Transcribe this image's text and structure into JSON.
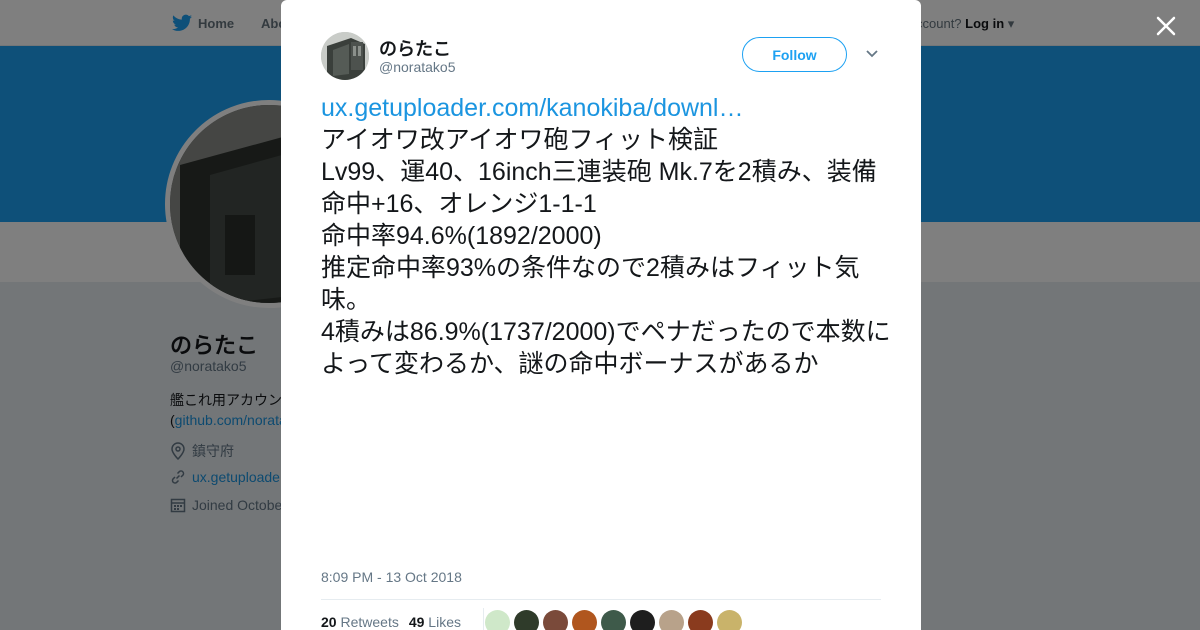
{
  "background": {
    "nav": {
      "home_label": "Home",
      "about_label": "Abo",
      "account_prompt": "ccount?",
      "login_label": "Log in"
    },
    "profile": {
      "name": "のらたこ",
      "handle": "@noratako5",
      "bio_line1": "艦これ用アカウン",
      "bio_link_prefix": "(",
      "bio_link": "github.com/norata",
      "location": "鎮守府",
      "website": "ux.getuploade",
      "joined": "Joined Octobe"
    },
    "colors": {
      "banner": "#1da1f2",
      "link": "#1b95e0"
    }
  },
  "tweet": {
    "author": {
      "name": "のらたこ",
      "handle": "@noratako5"
    },
    "follow_label": "Follow",
    "link_text": "ux.getuploader.com/kanokiba/downl…",
    "lines": [
      "アイオワ改アイオワ砲フィット検証",
      "Lv99、運40、16inch三連装砲 Mk.7を2積み、装備命中+16、オレンジ1-1-1",
      "命中率94.6%(1892/2000)",
      "推定命中率93%の条件なので2積みはフィット気味。",
      "4積みは86.9%(1737/2000)でペナだったので本数によって変わるか、謎の命中ボーナスがあるか"
    ],
    "timestamp": "8:09 PM - 13 Oct 2018",
    "retweets_count": "20",
    "retweets_label": "Retweets",
    "likes_count": "49",
    "likes_label": "Likes",
    "liker_colors": [
      "#cfe8c9",
      "#2f3b2a",
      "#7a4a3a",
      "#b0561e",
      "#3e5a4a",
      "#1e1e1e",
      "#b8a28a",
      "#8a3b1e",
      "#c9b36a"
    ]
  },
  "icons": [
    "twitter-bird-icon",
    "close-icon",
    "chevron-down-icon",
    "location-icon",
    "link-icon",
    "calendar-icon"
  ]
}
